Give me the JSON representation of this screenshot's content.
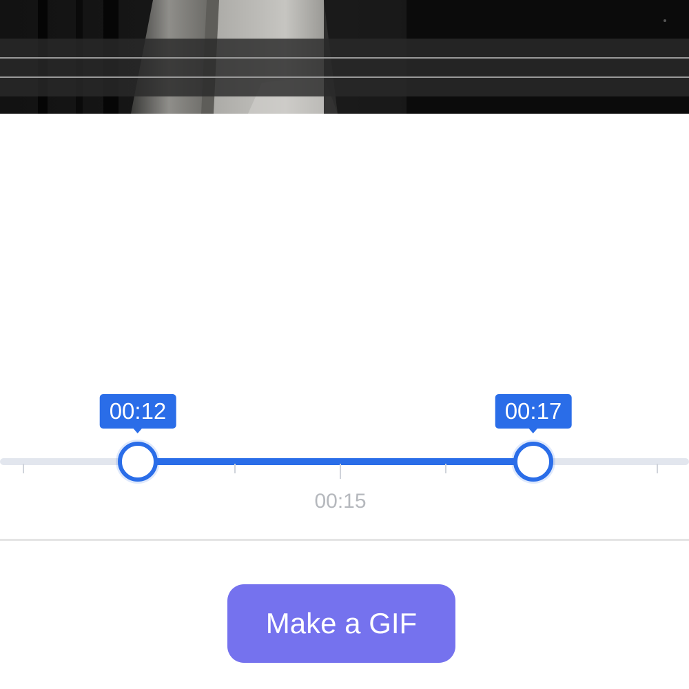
{
  "trimmer": {
    "start_label": "00:12",
    "end_label": "00:17",
    "center_tick_label": "00:15",
    "start_fraction": 0.2,
    "end_fraction": 0.774,
    "accent_color": "#2a6de8"
  },
  "actions": {
    "make_gif_label": "Make a GIF",
    "button_color": "#7572ee"
  }
}
